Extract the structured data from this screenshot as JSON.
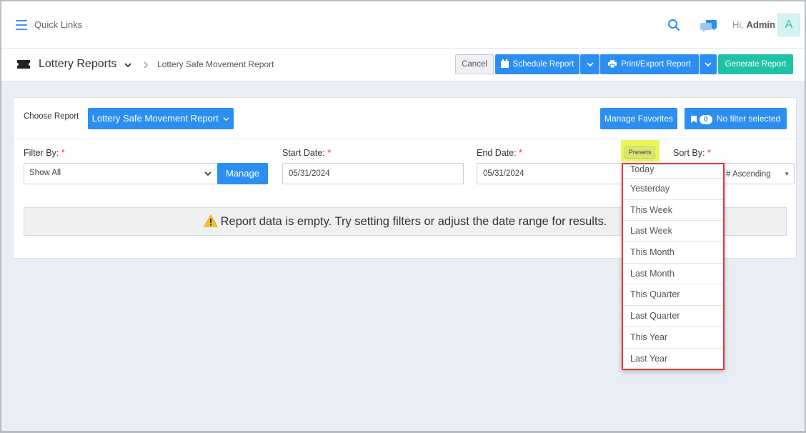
{
  "topbar": {
    "quick_links": "Quick Links",
    "greeting_prefix": "Hi,",
    "user_name": "Admin",
    "avatar_initial": "A"
  },
  "header": {
    "title": "Lottery Reports",
    "breadcrumb": "Lottery Safe Movement Report",
    "cancel_label": "Cancel",
    "schedule_label": "Schedule Report",
    "print_label": "Print/Export Report",
    "generate_label": "Generate Report"
  },
  "report_bar": {
    "choose_label": "Choose Report",
    "selected_report": "Lottery Safe Movement Report",
    "manage_favorites_label": "Manage Favorites",
    "filter_count": "0",
    "filter_status": "No filter selected"
  },
  "filters": {
    "filter_by_label": "Filter By:",
    "filter_by_value": "Show All",
    "manage_label": "Manage",
    "start_date_label": "Start Date:",
    "start_date_value": "05/31/2024",
    "end_date_label": "End Date:",
    "end_date_value": "05/31/2024",
    "presets_label": "Presets",
    "sort_by_label": "Sort By:",
    "sort_by_value": "# Ascending",
    "required_mark": "*"
  },
  "empty_message": "Report data is empty. Try setting filters or adjust the date range for results.",
  "presets_menu": {
    "items": [
      "Today",
      "Yesterday",
      "This Week",
      "Last Week",
      "This Month",
      "Last Month",
      "This Quarter",
      "Last Quarter",
      "This Year",
      "Last Year"
    ]
  },
  "colors": {
    "primary": "#2b8ef0",
    "teal": "#1fc2a8",
    "highlight_yellow": "#e9f55c",
    "annotation_red": "#e0393f"
  }
}
